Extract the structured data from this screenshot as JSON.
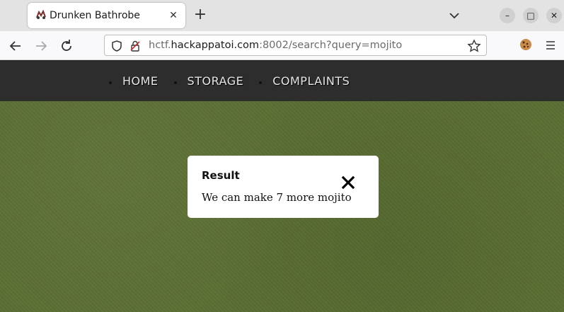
{
  "browser": {
    "tab": {
      "title": "Drunken Bathrobe",
      "close_icon": "close-icon"
    },
    "new_tab": "+",
    "url": {
      "host_prefix": "hctf.",
      "host_main": "hackappatoi.com",
      "rest": ":8002/search?query=mojito"
    },
    "window_controls": {
      "minimize": "–",
      "maximize": "□",
      "close": "✕"
    }
  },
  "site": {
    "nav": [
      {
        "label": "HOME"
      },
      {
        "label": "STORAGE"
      },
      {
        "label": "COMPLAINTS"
      }
    ]
  },
  "modal": {
    "title": "Result",
    "message": "We can make 7 more mojito"
  },
  "colors": {
    "header_bg": "#2d2d2d",
    "main_bg": "#5b6e33",
    "modal_bg": "#ffffff"
  }
}
